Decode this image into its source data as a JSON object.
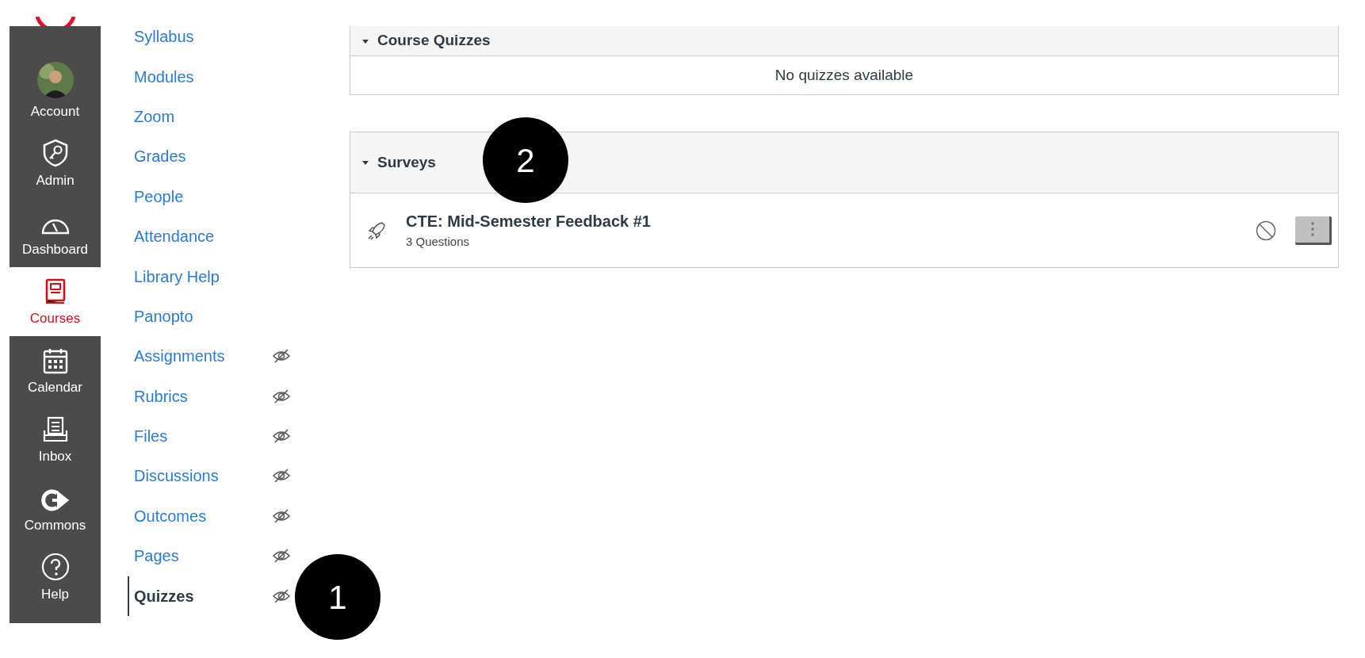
{
  "global_nav": {
    "items": [
      {
        "label": "Account",
        "selected": false
      },
      {
        "label": "Admin",
        "selected": false
      },
      {
        "label": "Dashboard",
        "selected": false
      },
      {
        "label": "Courses",
        "selected": true
      },
      {
        "label": "Calendar",
        "selected": false
      },
      {
        "label": "Inbox",
        "selected": false
      },
      {
        "label": "Commons",
        "selected": false
      },
      {
        "label": "Help",
        "selected": false
      }
    ]
  },
  "course_nav": {
    "items": [
      {
        "label": "Syllabus",
        "selected": false,
        "hidden": false
      },
      {
        "label": "Modules",
        "selected": false,
        "hidden": false
      },
      {
        "label": "Zoom",
        "selected": false,
        "hidden": false
      },
      {
        "label": "Grades",
        "selected": false,
        "hidden": false
      },
      {
        "label": "People",
        "selected": false,
        "hidden": false
      },
      {
        "label": "Attendance",
        "selected": false,
        "hidden": false
      },
      {
        "label": "Library Help",
        "selected": false,
        "hidden": false
      },
      {
        "label": "Panopto",
        "selected": false,
        "hidden": false
      },
      {
        "label": "Assignments",
        "selected": false,
        "hidden": true
      },
      {
        "label": "Rubrics",
        "selected": false,
        "hidden": true
      },
      {
        "label": "Files",
        "selected": false,
        "hidden": true
      },
      {
        "label": "Discussions",
        "selected": false,
        "hidden": true
      },
      {
        "label": "Outcomes",
        "selected": false,
        "hidden": true
      },
      {
        "label": "Pages",
        "selected": false,
        "hidden": true
      },
      {
        "label": "Quizzes",
        "selected": true,
        "hidden": true
      }
    ]
  },
  "sections": [
    {
      "title": "Course Quizzes",
      "expanded": true,
      "empty_text": "No quizzes available"
    },
    {
      "title": "Surveys",
      "expanded": true,
      "items": [
        {
          "title": "CTE: Mid-Semester Feedback #1",
          "meta": "3 Questions",
          "published": false
        }
      ]
    }
  ],
  "callouts": [
    {
      "label": "1"
    },
    {
      "label": "2"
    }
  ]
}
